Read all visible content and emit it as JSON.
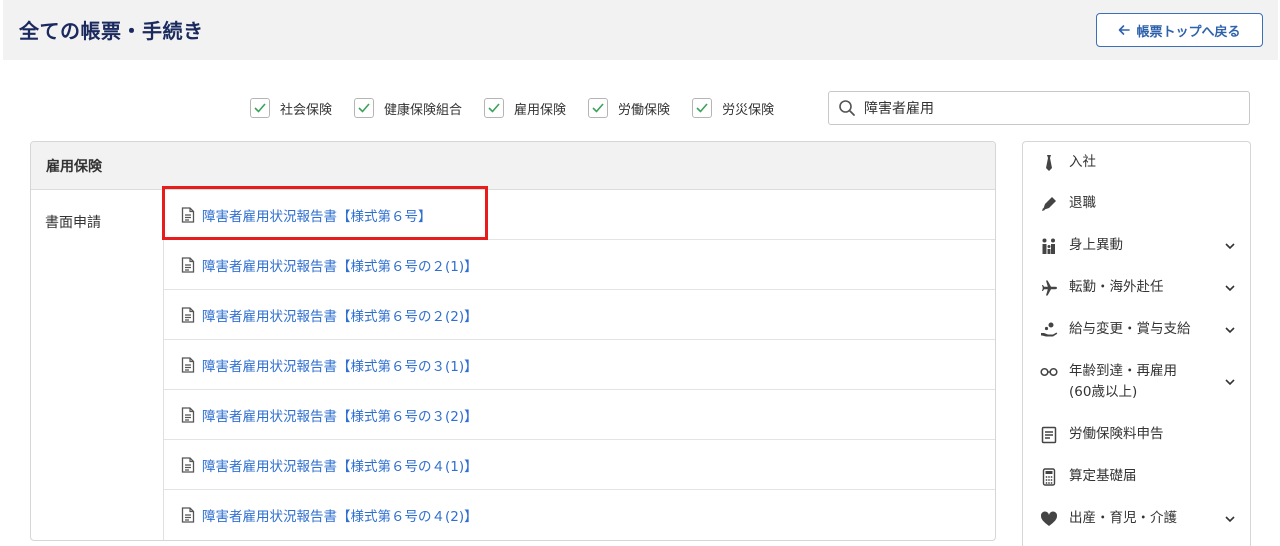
{
  "header": {
    "title": "全ての帳票・手続き",
    "back_label": "帳票トップへ戻る"
  },
  "filters": [
    {
      "label": "社会保険",
      "checked": true
    },
    {
      "label": "健康保険組合",
      "checked": true
    },
    {
      "label": "雇用保険",
      "checked": true
    },
    {
      "label": "労働保険",
      "checked": true
    },
    {
      "label": "労災保険",
      "checked": true
    }
  ],
  "search": {
    "value": "障害者雇用"
  },
  "panel": {
    "title": "雇用保険",
    "category": "書面申請",
    "items": [
      "障害者雇用状況報告書【様式第６号】",
      "障害者雇用状況報告書【様式第６号の２(1)】",
      "障害者雇用状況報告書【様式第６号の２(2)】",
      "障害者雇用状況報告書【様式第６号の３(1)】",
      "障害者雇用状況報告書【様式第６号の３(2)】",
      "障害者雇用状況報告書【様式第６号の４(1)】",
      "障害者雇用状況報告書【様式第６号の４(2)】"
    ]
  },
  "sidebar": {
    "items": [
      {
        "label": "入社",
        "icon": "tie-icon",
        "expandable": false
      },
      {
        "label": "退職",
        "icon": "pen-icon",
        "expandable": false
      },
      {
        "label": "身上異動",
        "icon": "family-icon",
        "expandable": true
      },
      {
        "label": "転勤・海外赴任",
        "icon": "airplane-icon",
        "expandable": true
      },
      {
        "label": "給与変更・賞与支給",
        "icon": "money-hand-icon",
        "expandable": true
      },
      {
        "label": "年齢到達・再雇用",
        "label2": "(60歳以上)",
        "icon": "glasses-icon",
        "expandable": true
      },
      {
        "label": "労働保険料申告",
        "icon": "document-list-icon",
        "expandable": false
      },
      {
        "label": "算定基礎届",
        "icon": "calculator-icon",
        "expandable": false
      },
      {
        "label": "出産・育児・介護",
        "icon": "heart-icon",
        "expandable": true
      }
    ]
  },
  "colors": {
    "accent": "#2f62ad",
    "link": "#2f6fd0",
    "highlight": "#e81c1c",
    "checkmark": "#3aa35a"
  }
}
